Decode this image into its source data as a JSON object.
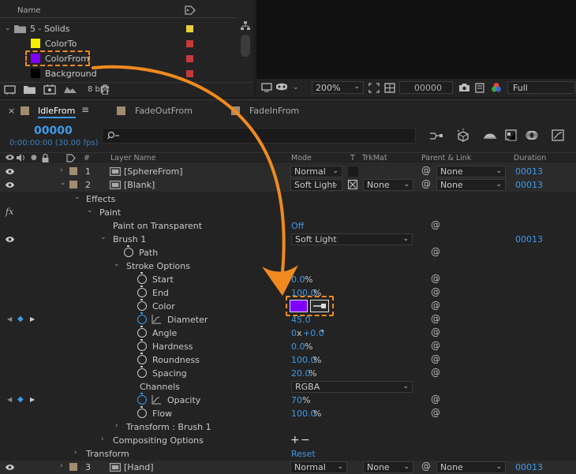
{
  "project": {
    "header_name": "Name",
    "folder": "5 - Solids",
    "items": [
      {
        "name": "ColorTo",
        "swatch": "#f5f000",
        "label": "#c43a3a"
      },
      {
        "name": "ColorFrom",
        "swatch": "#7f00ff",
        "label": "#c43a3a"
      },
      {
        "name": "Background",
        "swatch": "#000000",
        "label": "#c43a3a"
      }
    ],
    "folder_label": "#e6d23a",
    "bpc": "8 bpc"
  },
  "viewer": {
    "zoom": "200%",
    "timecode": "00000",
    "resolution": "Full"
  },
  "timeline": {
    "tabs": [
      {
        "label": "IdleFrom",
        "active": true
      },
      {
        "label": "FadeOutFrom",
        "active": false
      },
      {
        "label": "FadeInFrom",
        "active": false
      }
    ],
    "current_frame": "00000",
    "current_time": "0:00:00:00 (30.00 fps)",
    "search_placeholder": "",
    "columns": {
      "hash": "#",
      "layer_name": "Layer Name",
      "mode": "Mode",
      "t": "T",
      "trkmat": "TrkMat",
      "parent": "Parent & Link",
      "duration": "Duration"
    },
    "layers": {
      "l1": {
        "num": "1",
        "name": "[SphereFrom]",
        "mode": "Normal",
        "parent": "None",
        "duration": "00013"
      },
      "l2": {
        "num": "2",
        "name": "[Blank]",
        "mode": "Soft Light",
        "trkmat": "None",
        "parent": "None",
        "duration": "00013"
      },
      "l3": {
        "num": "3",
        "name": "[Hand]",
        "mode": "Normal",
        "trkmat": "None",
        "parent": "None",
        "duration": "00013"
      }
    },
    "props": {
      "effects": "Effects",
      "paint": "Paint",
      "paint_on_transparent": "Paint on Transparent",
      "paint_on_transparent_val": "Off",
      "brush1": "Brush 1",
      "brush1_mode": "Soft Light",
      "brush1_duration": "00013",
      "path": "Path",
      "stroke_options": "Stroke Options",
      "start": "Start",
      "start_val": "0.0",
      "start_unit": "%",
      "end": "End",
      "end_val": "100.0",
      "end_unit": "%",
      "color": "Color",
      "color_val": "#7f00ff",
      "diameter": "Diameter",
      "diameter_val": "45.0",
      "angle": "Angle",
      "angle_val": "0",
      "angle_sep": "x",
      "angle_deg": "+0.0",
      "angle_unit": "°",
      "hardness": "Hardness",
      "hardness_val": "0.0",
      "hardness_unit": "%",
      "roundness": "Roundness",
      "roundness_val": "100.0",
      "roundness_unit": "%",
      "spacing": "Spacing",
      "spacing_val": "20.0",
      "spacing_unit": "%",
      "channels": "Channels",
      "channels_val": "RGBA",
      "opacity": "Opacity",
      "opacity_val": "70",
      "opacity_unit": "%",
      "flow": "Flow",
      "flow_val": "100.0",
      "flow_unit": "%",
      "transform_brush": "Transform : Brush 1",
      "compositing": "Compositing Options",
      "transform": "Transform",
      "reset": "Reset"
    }
  },
  "colors": {
    "accent_blue": "#3d9ae8",
    "highlight_orange": "#f08a1e",
    "layer_label": "#a08c6e"
  }
}
